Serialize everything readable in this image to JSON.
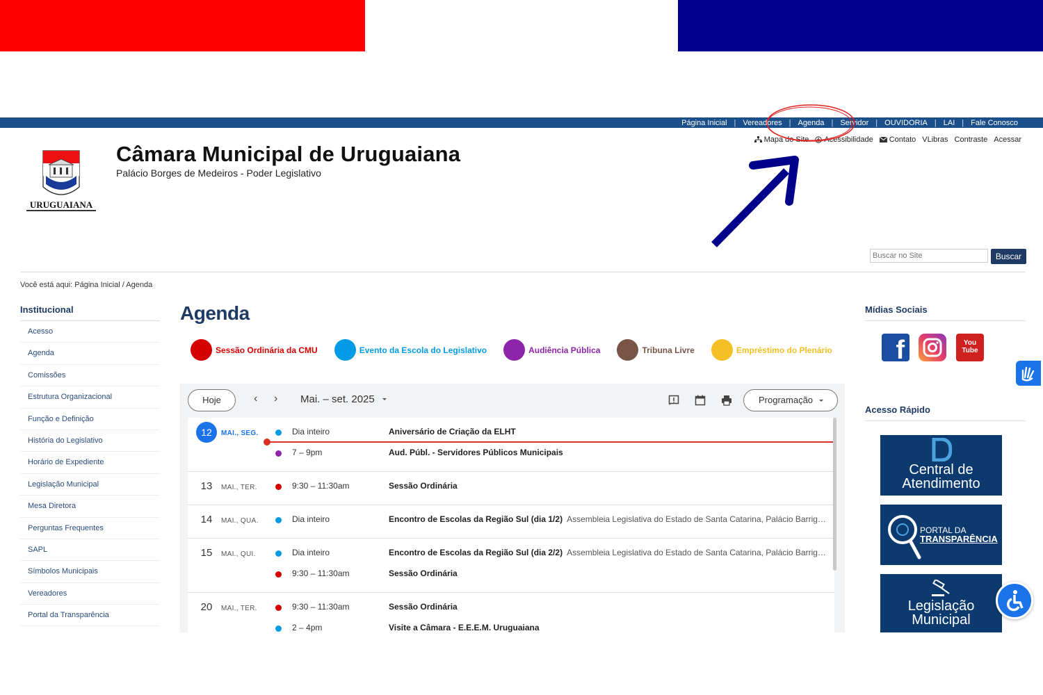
{
  "colors": {
    "flag_red": "#ff0000",
    "flag_blue": "#000090",
    "nav_blue": "#1a4f8a",
    "title_blue": "#1f3a64",
    "annotation_red": "#e02020",
    "annotation_arrow": "#00008b"
  },
  "topnav": [
    "Página Inicial",
    "Vereadores",
    "Agenda",
    "Servidor",
    "OUVIDORIA",
    "LAI",
    "Fale Conosco"
  ],
  "utility": {
    "mapa": "Mapa do Site",
    "acess": "Acessibilidade",
    "contato": "Contato",
    "vlibras": "VLibras",
    "contraste": "Contraste",
    "acessar": "Acessar"
  },
  "site": {
    "title": "Câmara Municipal de Uruguaiana",
    "subtitle": "Palácio Borges de Medeiros - Poder Legislativo",
    "logo_text": "URUGUAIANA"
  },
  "search": {
    "placeholder": "Buscar no Site",
    "button": "Buscar"
  },
  "breadcrumb": {
    "prefix": "Você está aqui: ",
    "home": "Página Inicial",
    "sep": " / ",
    "current": "Agenda"
  },
  "sidebar": {
    "title": "Institucional",
    "items": [
      "Acesso",
      "Agenda",
      "Comissões",
      "Estrutura Organizacional",
      "Função e Definição",
      "História do Legislativo",
      "Horário de Expediente",
      "Legislação Municipal",
      "Mesa Diretora",
      "Perguntas Frequentes",
      "SAPL",
      "Símbolos Municipais",
      "Vereadores",
      "Portal da Transparência"
    ]
  },
  "main": {
    "title": "Agenda"
  },
  "legend": [
    {
      "label": "Sessão Ordinária da CMU",
      "color": "#d50000"
    },
    {
      "label": "Evento da Escola do Legislativo",
      "color": "#039be5"
    },
    {
      "label": "Audiência Pública",
      "color": "#8e24aa"
    },
    {
      "label": "Tribuna Livre",
      "color": "#795548"
    },
    {
      "label": "Empréstimo do Plenário",
      "color": "#f6bf26"
    }
  ],
  "calendar": {
    "today_button": "Hoje",
    "prev": "‹",
    "next": "›",
    "range": "Mai. – set. 2025",
    "view_button": "Programação",
    "days": [
      {
        "num": "12",
        "name": "MAI., SEG.",
        "today": true,
        "events": [
          {
            "time": "Dia inteiro",
            "title": "Aniversário de Criação da ELHT",
            "location": "",
            "color": "#039be5"
          },
          {
            "time": "7 – 9pm",
            "title": "Aud. Públ. - Servidores Públicos Municipais",
            "location": "",
            "color": "#8e24aa"
          }
        ]
      },
      {
        "num": "13",
        "name": "MAI., TER.",
        "today": false,
        "events": [
          {
            "time": "9:30 – 11:30am",
            "title": "Sessão Ordinária",
            "location": "",
            "color": "#d50000"
          }
        ]
      },
      {
        "num": "14",
        "name": "MAI., QUA.",
        "today": false,
        "events": [
          {
            "time": "Dia inteiro",
            "title": "Encontro de Escolas da Região Sul (dia 1/2)",
            "location": "Assembleia Legislativa do Estado de Santa Catarina, Palácio Barrig…",
            "color": "#039be5"
          }
        ]
      },
      {
        "num": "15",
        "name": "MAI., QUI.",
        "today": false,
        "events": [
          {
            "time": "Dia inteiro",
            "title": "Encontro de Escolas da Região Sul (dia 2/2)",
            "location": "Assembleia Legislativa do Estado de Santa Catarina, Palácio Barrig…",
            "color": "#039be5"
          },
          {
            "time": "9:30 – 11:30am",
            "title": "Sessão Ordinária",
            "location": "",
            "color": "#d50000"
          }
        ]
      },
      {
        "num": "20",
        "name": "MAI., TER.",
        "today": false,
        "events": [
          {
            "time": "9:30 – 11:30am",
            "title": "Sessão Ordinária",
            "location": "",
            "color": "#d50000"
          },
          {
            "time": "2 – 4pm",
            "title": "Visite a Câmara - E.E.E.M. Uruguaiana",
            "location": "",
            "color": "#039be5"
          }
        ]
      }
    ]
  },
  "right": {
    "social_title": "Mídias Sociais",
    "social": [
      "f",
      "Instagram",
      "You Tube"
    ],
    "quick_title": "Acesso Rápido",
    "quick": [
      {
        "line1": "Central de",
        "line2": "Atendimento"
      },
      {
        "line1": "PORTAL DA",
        "line2": "TRANSPARÊNCIA"
      },
      {
        "line1": "Legislação",
        "line2": "Municipal"
      }
    ]
  }
}
